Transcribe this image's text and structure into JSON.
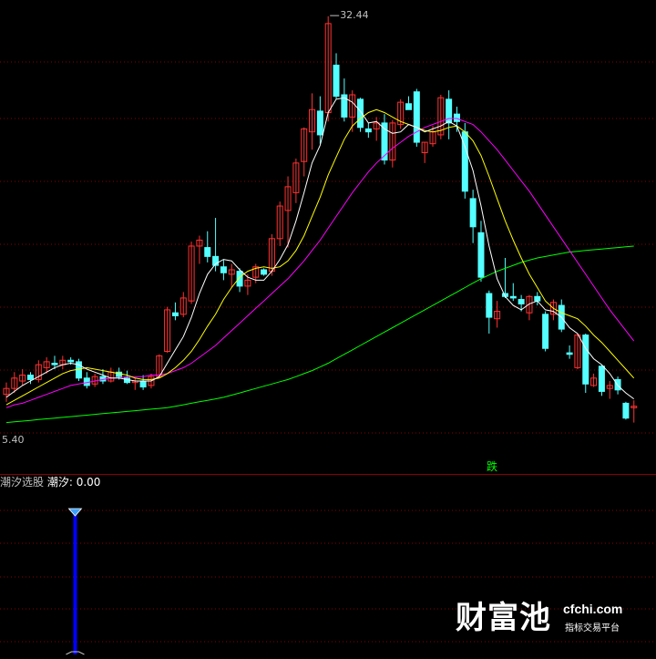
{
  "colors": {
    "background": "#000000",
    "up_candle": "#ff3232",
    "down_candle": "#54ffff",
    "ma5": "#ffffff",
    "ma10": "#ffff00",
    "ma20": "#ff00ff",
    "ma60": "#00ff00",
    "grid": "#8b0000",
    "signal_text": "#00ff00",
    "indicator_bar": "#0000ff",
    "indicator_marker": "#3aa0ff"
  },
  "labels": {
    "high_price": "32.44",
    "low_price": "5.40",
    "signal": "跌",
    "indicator_name": "潮汐选股",
    "indicator_value_label": "潮汐: 0.00"
  },
  "watermark": {
    "brand_cn": "财富池",
    "brand_en": "cfchi.com",
    "brand_sub": "指标交易平台"
  },
  "chart_data": {
    "type": "candlestick",
    "ylim": [
      3.5,
      33
    ],
    "high": 32.44,
    "low": 5.4,
    "candles": [
      [
        6.9,
        7.7,
        6.4,
        7.3
      ],
      [
        7.3,
        8.4,
        7.0,
        8.0
      ],
      [
        7.8,
        8.6,
        7.5,
        8.2
      ],
      [
        8.2,
        8.4,
        7.6,
        7.9
      ],
      [
        7.9,
        9.2,
        7.7,
        8.9
      ],
      [
        8.7,
        9.4,
        8.3,
        9.1
      ],
      [
        9.0,
        9.5,
        8.6,
        8.9
      ],
      [
        8.9,
        9.5,
        8.6,
        9.2
      ],
      [
        9.2,
        9.4,
        8.9,
        9.1
      ],
      [
        9.1,
        9.3,
        7.8,
        8.0
      ],
      [
        8.0,
        8.4,
        7.3,
        7.5
      ],
      [
        7.6,
        8.3,
        7.4,
        8.1
      ],
      [
        8.1,
        8.6,
        7.6,
        7.8
      ],
      [
        7.8,
        8.7,
        7.7,
        8.4
      ],
      [
        8.4,
        8.7,
        7.9,
        8.1
      ],
      [
        8.0,
        8.5,
        7.6,
        7.7
      ],
      [
        7.7,
        8.0,
        7.2,
        7.8
      ],
      [
        7.8,
        8.2,
        7.2,
        7.4
      ],
      [
        7.5,
        8.3,
        7.3,
        8.1
      ],
      [
        8.1,
        9.6,
        8.0,
        9.5
      ],
      [
        9.8,
        12.8,
        9.7,
        12.6
      ],
      [
        12.4,
        13.1,
        11.9,
        12.2
      ],
      [
        12.3,
        13.8,
        12.1,
        13.4
      ],
      [
        13.2,
        17.2,
        13.0,
        16.9
      ],
      [
        16.9,
        17.6,
        15.7,
        17.3
      ],
      [
        16.8,
        17.9,
        15.8,
        16.2
      ],
      [
        16.2,
        18.8,
        15.2,
        15.6
      ],
      [
        15.5,
        16.0,
        14.6,
        15.1
      ],
      [
        15.0,
        15.7,
        14.1,
        15.3
      ],
      [
        15.2,
        15.4,
        13.8,
        14.2
      ],
      [
        14.2,
        15.0,
        13.6,
        14.6
      ],
      [
        14.8,
        15.7,
        14.4,
        15.5
      ],
      [
        15.3,
        15.4,
        14.9,
        15.0
      ],
      [
        15.2,
        17.7,
        14.9,
        17.4
      ],
      [
        17.4,
        19.9,
        16.9,
        19.6
      ],
      [
        19.3,
        21.6,
        16.8,
        20.9
      ],
      [
        20.5,
        22.8,
        19.8,
        22.5
      ],
      [
        22.6,
        24.9,
        21.6,
        24.8
      ],
      [
        24.6,
        27.2,
        23.4,
        26.1
      ],
      [
        26.0,
        27.0,
        23.8,
        24.4
      ],
      [
        25.9,
        32.4,
        25.3,
        31.9
      ],
      [
        29.1,
        29.9,
        26.8,
        27.0
      ],
      [
        27.1,
        28.2,
        25.3,
        25.6
      ],
      [
        25.6,
        27.4,
        24.6,
        27.1
      ],
      [
        26.8,
        26.9,
        24.6,
        24.9
      ],
      [
        24.8,
        25.2,
        24.2,
        24.6
      ],
      [
        24.8,
        25.6,
        24.0,
        25.2
      ],
      [
        25.2,
        25.8,
        22.4,
        22.7
      ],
      [
        22.7,
        25.4,
        22.2,
        25.2
      ],
      [
        25.1,
        26.8,
        24.8,
        26.6
      ],
      [
        26.5,
        27.0,
        26.1,
        26.1
      ],
      [
        27.3,
        27.5,
        23.6,
        23.9
      ],
      [
        23.2,
        23.9,
        22.5,
        23.9
      ],
      [
        23.8,
        25.0,
        23.6,
        24.6
      ],
      [
        24.4,
        27.1,
        24.1,
        26.9
      ],
      [
        26.8,
        27.4,
        24.1,
        25.2
      ],
      [
        25.8,
        26.3,
        24.6,
        25.3
      ],
      [
        24.6,
        25.2,
        20.1,
        20.6
      ],
      [
        20.1,
        20.7,
        17.1,
        18.2
      ],
      [
        17.8,
        18.6,
        14.5,
        14.8
      ],
      [
        13.7,
        13.9,
        11.0,
        12.1
      ],
      [
        12.0,
        13.2,
        11.4,
        12.5
      ],
      [
        13.7,
        16.1,
        13.4,
        13.5
      ],
      [
        13.5,
        14.4,
        13.2,
        13.4
      ],
      [
        13.3,
        13.6,
        12.5,
        13.0
      ],
      [
        12.4,
        13.6,
        11.9,
        13.5
      ],
      [
        13.5,
        13.8,
        12.9,
        13.2
      ],
      [
        12.3,
        12.5,
        9.8,
        10.0
      ],
      [
        12.3,
        13.3,
        11.9,
        13.1
      ],
      [
        12.9,
        13.3,
        11.1,
        11.3
      ],
      [
        9.7,
        10.2,
        9.3,
        9.6
      ],
      [
        8.7,
        11.0,
        8.6,
        10.9
      ],
      [
        10.9,
        11.0,
        7.0,
        7.6
      ],
      [
        7.5,
        8.3,
        7.4,
        8.0
      ],
      [
        8.8,
        8.9,
        6.8,
        7.1
      ],
      [
        7.3,
        7.8,
        6.6,
        7.5
      ],
      [
        7.9,
        8.1,
        6.9,
        7.2
      ],
      [
        6.3,
        6.4,
        5.2,
        5.3
      ],
      [
        6.0,
        6.5,
        5.0,
        6.1
      ]
    ],
    "ma5": [
      6.7,
      7.1,
      7.5,
      7.8,
      8.1,
      8.4,
      8.7,
      8.9,
      9.0,
      8.9,
      8.6,
      8.4,
      8.2,
      8.0,
      8.0,
      7.9,
      7.8,
      7.8,
      7.8,
      8.1,
      9.0,
      9.9,
      10.8,
      12.1,
      13.7,
      15.0,
      15.7,
      16.0,
      15.9,
      15.3,
      14.8,
      14.6,
      14.6,
      15.2,
      16.0,
      17.0,
      18.6,
      20.5,
      22.5,
      23.7,
      25.9,
      26.8,
      26.9,
      26.6,
      26.0,
      25.2,
      25.3,
      24.8,
      24.5,
      24.6,
      25.1,
      24.9,
      24.6,
      24.8,
      25.0,
      25.3,
      25.0,
      23.6,
      22.0,
      19.6,
      16.9,
      14.7,
      13.5,
      12.9,
      12.6,
      13.0,
      13.2,
      12.6,
      12.5,
      12.1,
      11.4,
      11.0,
      10.0,
      9.3,
      8.9,
      8.3,
      7.5,
      7.0,
      6.6
    ],
    "ma10": [
      6.2,
      6.5,
      6.8,
      7.1,
      7.4,
      7.7,
      8.0,
      8.3,
      8.5,
      8.6,
      8.7,
      8.6,
      8.5,
      8.4,
      8.3,
      8.2,
      8.0,
      7.9,
      7.9,
      8.0,
      8.3,
      8.7,
      9.2,
      9.8,
      10.6,
      11.5,
      12.3,
      13.3,
      14.1,
      14.8,
      15.2,
      15.4,
      15.5,
      15.4,
      15.5,
      15.9,
      16.6,
      17.6,
      18.9,
      20.2,
      21.7,
      22.9,
      24.1,
      25.0,
      25.5,
      25.9,
      26.1,
      25.9,
      25.6,
      25.3,
      25.1,
      24.9,
      24.7,
      24.6,
      24.7,
      24.9,
      25.0,
      24.6,
      24.0,
      23.0,
      21.6,
      20.1,
      18.6,
      17.3,
      16.1,
      15.0,
      14.1,
      13.2,
      12.7,
      12.4,
      12.2,
      12.0,
      11.5,
      10.9,
      10.4,
      9.8,
      9.2,
      8.6,
      8.0
    ],
    "ma20": [
      6.0,
      6.2,
      6.3,
      6.5,
      6.7,
      6.9,
      7.1,
      7.3,
      7.5,
      7.6,
      7.7,
      7.8,
      7.9,
      8.0,
      8.0,
      8.1,
      8.1,
      8.1,
      8.2,
      8.2,
      8.3,
      8.5,
      8.7,
      9.0,
      9.4,
      9.8,
      10.2,
      10.7,
      11.2,
      11.7,
      12.2,
      12.7,
      13.2,
      13.7,
      14.2,
      14.7,
      15.3,
      15.9,
      16.6,
      17.3,
      18.1,
      18.9,
      19.7,
      20.5,
      21.2,
      21.9,
      22.5,
      23.0,
      23.5,
      23.9,
      24.3,
      24.6,
      24.9,
      25.1,
      25.3,
      25.5,
      25.5,
      25.3,
      25.1,
      24.6,
      24.0,
      23.4,
      22.7,
      22.0,
      21.3,
      20.6,
      19.8,
      19.0,
      18.2,
      17.4,
      16.6,
      15.8,
      15.0,
      14.2,
      13.4,
      12.6,
      11.9,
      11.2,
      10.5
    ],
    "ma60": [
      5.0,
      5.05,
      5.1,
      5.15,
      5.2,
      5.25,
      5.3,
      5.35,
      5.4,
      5.45,
      5.5,
      5.55,
      5.6,
      5.65,
      5.7,
      5.75,
      5.8,
      5.85,
      5.9,
      5.95,
      6.0,
      6.1,
      6.2,
      6.3,
      6.4,
      6.5,
      6.6,
      6.7,
      6.85,
      7.0,
      7.15,
      7.3,
      7.45,
      7.6,
      7.75,
      7.9,
      8.1,
      8.3,
      8.5,
      8.75,
      9.0,
      9.3,
      9.6,
      9.9,
      10.2,
      10.5,
      10.8,
      11.1,
      11.4,
      11.7,
      12.0,
      12.3,
      12.6,
      12.9,
      13.2,
      13.5,
      13.8,
      14.1,
      14.4,
      14.7,
      14.95,
      15.2,
      15.4,
      15.6,
      15.8,
      15.95,
      16.1,
      16.2,
      16.3,
      16.4,
      16.5,
      16.55,
      16.6,
      16.65,
      16.7,
      16.75,
      16.8,
      16.85,
      16.9
    ],
    "indicator": {
      "name": "潮汐选股",
      "series_name": "潮汐",
      "value": 0.0,
      "signal_index": 9,
      "signal_value": 1,
      "ylim": [
        0,
        1.05
      ]
    }
  }
}
